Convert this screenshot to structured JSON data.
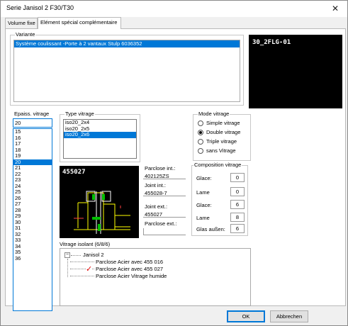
{
  "window": {
    "title": "Serie Janisol 2 F30/T30",
    "close_glyph": "✕"
  },
  "tabs": [
    {
      "label": "Volume fixe"
    },
    {
      "label": "Elément spécial complémentaire"
    }
  ],
  "variante": {
    "legend": "Variante",
    "selected": "Système coulissant -Porte à 2 vantaux  Stulp 6036352",
    "preview_code": "30_2FLG-01"
  },
  "epaisseur": {
    "legend": "Epaiss. vitrage",
    "input_value": "20",
    "items": [
      "15",
      "16",
      "17",
      "18",
      "19",
      "20",
      "21",
      "22",
      "23",
      "24",
      "25",
      "26",
      "27",
      "28",
      "29",
      "30",
      "31",
      "32",
      "33",
      "34",
      "35",
      "36"
    ],
    "selected": "20"
  },
  "type_vitrage": {
    "legend": "Type vitrage",
    "items": [
      "iso20_2x4",
      "iso20_2x5",
      "iso20_2x6"
    ],
    "selected": "iso20_2x6"
  },
  "mode_vitrage": {
    "legend": "Mode vitrage",
    "options": [
      {
        "label": "Simple vitrage",
        "checked": false
      },
      {
        "label": "Double vitrage",
        "checked": true
      },
      {
        "label": "Triple vitrage",
        "checked": false
      },
      {
        "label": "sans Vitrage",
        "checked": false
      }
    ]
  },
  "profile": {
    "code": "455027",
    "parclose_int_label": "Parclose int.:",
    "parclose_int_value": "402125ZS",
    "joint_int_label": "Joint int.:",
    "joint_int_value": "455028-7",
    "joint_ext_label": "Joint ext.:",
    "joint_ext_value": "455027",
    "parclose_ext_label": "Parclose ext.:",
    "parclose_ext_value": ""
  },
  "composition": {
    "legend": "Composition vitrage",
    "rows": [
      {
        "label": "Glace:",
        "value": "0"
      },
      {
        "label": "Lame",
        "value": "0"
      },
      {
        "label": "Glace:",
        "value": "6"
      },
      {
        "label": "Lame",
        "value": "8"
      },
      {
        "label": "Glas außen:",
        "value": "6"
      }
    ]
  },
  "vitrage_isolant": {
    "legend": "Vitrage isolant  (6/8/6)",
    "root": "Janisol 2",
    "expander": "−",
    "children": [
      {
        "label": "Parclose Acier  avec  455 016",
        "checked": false
      },
      {
        "label": "Parclose Acier  avec  455 027",
        "checked": true
      },
      {
        "label": "Parclose Acier  Vitrage humide",
        "checked": false
      }
    ],
    "check_glyph": "✓"
  },
  "buttons": {
    "ok": "OK",
    "cancel": "Abbrechen"
  }
}
